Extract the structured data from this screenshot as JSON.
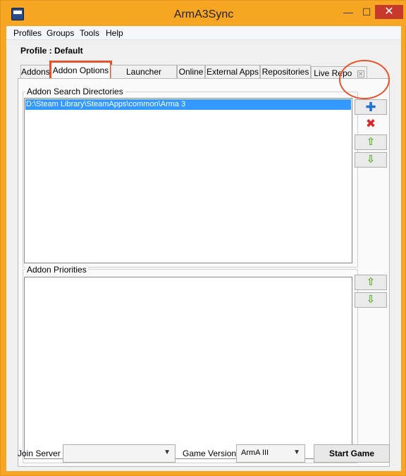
{
  "window": {
    "title": "ArmA3Sync",
    "minimize": "—",
    "maximize": "☐",
    "close": "✕"
  },
  "menu": [
    "Profiles",
    "Groups",
    "Tools",
    "Help"
  ],
  "profile_label": "Profile : Default",
  "tabs": [
    "Addons",
    "Addon Options",
    "Launcher Options",
    "Online",
    "External Apps",
    "Repositories",
    "Live Repo"
  ],
  "active_tab": "Addon Options",
  "search_dirs": {
    "title": "Addon Search Directories",
    "items": [
      "D:\\Steam Library\\SteamApps\\common\\Arma 3"
    ]
  },
  "priorities": {
    "title": "Addon Priorities",
    "items": []
  },
  "icons": {
    "add": "plus-icon",
    "remove": "x-icon",
    "up": "arrow-up-icon",
    "down": "arrow-down-icon"
  },
  "bottom": {
    "join_server_label": "Join Server",
    "join_server_value": "",
    "game_version_label": "Game Version",
    "game_version_value": "ArmA III",
    "start_button": "Start Game"
  },
  "colors": {
    "title_bar": "#f6a623",
    "highlight": "#e8532b",
    "selection": "#3399ff"
  }
}
